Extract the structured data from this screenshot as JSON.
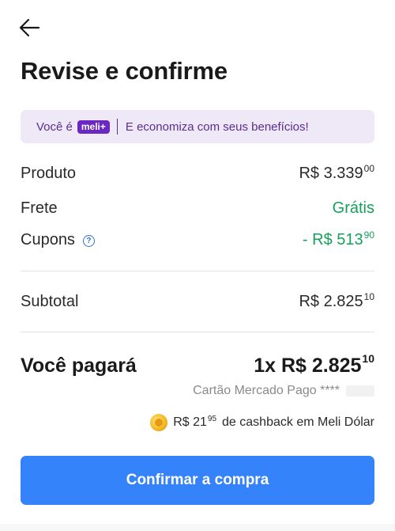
{
  "header": {
    "back_icon": "arrow-left-icon",
    "title": "Revise e confirme"
  },
  "banner": {
    "prefix": "Você é",
    "badge": "meli+",
    "text": "E economiza com seus benefícios!"
  },
  "summary": {
    "produto": {
      "label": "Produto",
      "value": "R$ 3.339",
      "cents": "00"
    },
    "frete": {
      "label": "Frete",
      "value": "Grátis"
    },
    "cupons": {
      "label": "Cupons",
      "help_icon": "question-circle-icon",
      "value": "- R$ 513",
      "cents": "90"
    },
    "subtotal": {
      "label": "Subtotal",
      "value": "R$ 2.825",
      "cents": "10"
    }
  },
  "total": {
    "label": "Você pagará",
    "value": "1x R$ 2.825",
    "cents": "10"
  },
  "payment": {
    "card_text": "Cartão Mercado Pago ****"
  },
  "cashback": {
    "icon": "meli-dolar-coin-icon",
    "amount": "R$ 21",
    "cents": "95",
    "text": "de cashback em Meli Dólar"
  },
  "actions": {
    "confirm_label": "Confirmar a compra"
  },
  "colors": {
    "primary": "#3483fa",
    "success": "#16a05a",
    "meli_purple": "#6a27c2",
    "banner_bg": "#efe8f6"
  }
}
